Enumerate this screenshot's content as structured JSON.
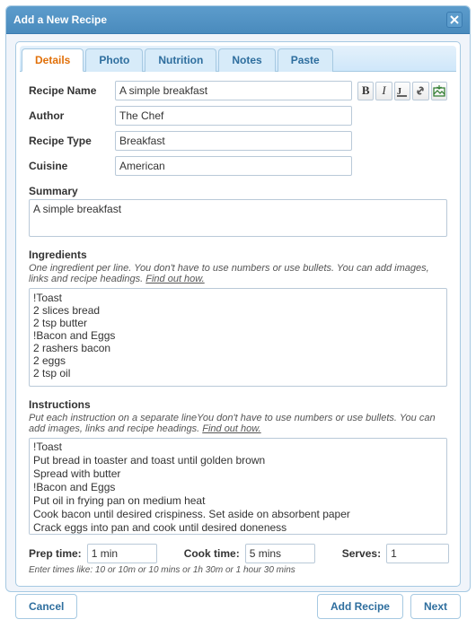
{
  "dialog": {
    "title": "Add a New Recipe"
  },
  "tabs": [
    {
      "label": "Details",
      "active": true
    },
    {
      "label": "Photo",
      "active": false
    },
    {
      "label": "Nutrition",
      "active": false
    },
    {
      "label": "Notes",
      "active": false
    },
    {
      "label": "Paste",
      "active": false
    }
  ],
  "toolbar": {
    "bold": "B",
    "italic": "I"
  },
  "labels": {
    "recipe_name": "Recipe Name",
    "author": "Author",
    "recipe_type": "Recipe Type",
    "cuisine": "Cuisine",
    "summary": "Summary",
    "ingredients": "Ingredients",
    "instructions": "Instructions",
    "prep_time": "Prep time:",
    "cook_time": "Cook time:",
    "serves": "Serves:"
  },
  "fields": {
    "recipe_name": "A simple breakfast",
    "author": "The Chef",
    "recipe_type": "Breakfast",
    "cuisine": "American",
    "summary": "A simple breakfast",
    "ingredients": "!Toast\n2 slices bread\n2 tsp butter\n!Bacon and Eggs\n2 rashers bacon\n2 eggs\n2 tsp oil",
    "instructions": "!Toast\nPut bread in toaster and toast until golden brown\nSpread with butter\n!Bacon and Eggs\nPut oil in frying pan on medium heat\nCook bacon until desired crispiness. Set aside on absorbent paper\nCrack eggs into pan and cook until desired doneness\nPlate up and eat",
    "prep_time": "1 min",
    "cook_time": "5 mins",
    "serves": "1"
  },
  "hints": {
    "ingredients": "One ingredient per line. You don't have to use numbers or use bullets. You can add images, links and recipe headings. ",
    "instructions": "Put each instruction on a separate lineYou don't have to use numbers or use bullets. You can add images, links and recipe headings. ",
    "find_out": "Find out how.",
    "times": "Enter times like: 10 or 10m or 10 mins or 1h 30m or 1 hour 30 mins"
  },
  "buttons": {
    "cancel": "Cancel",
    "add_recipe": "Add Recipe",
    "next": "Next"
  }
}
